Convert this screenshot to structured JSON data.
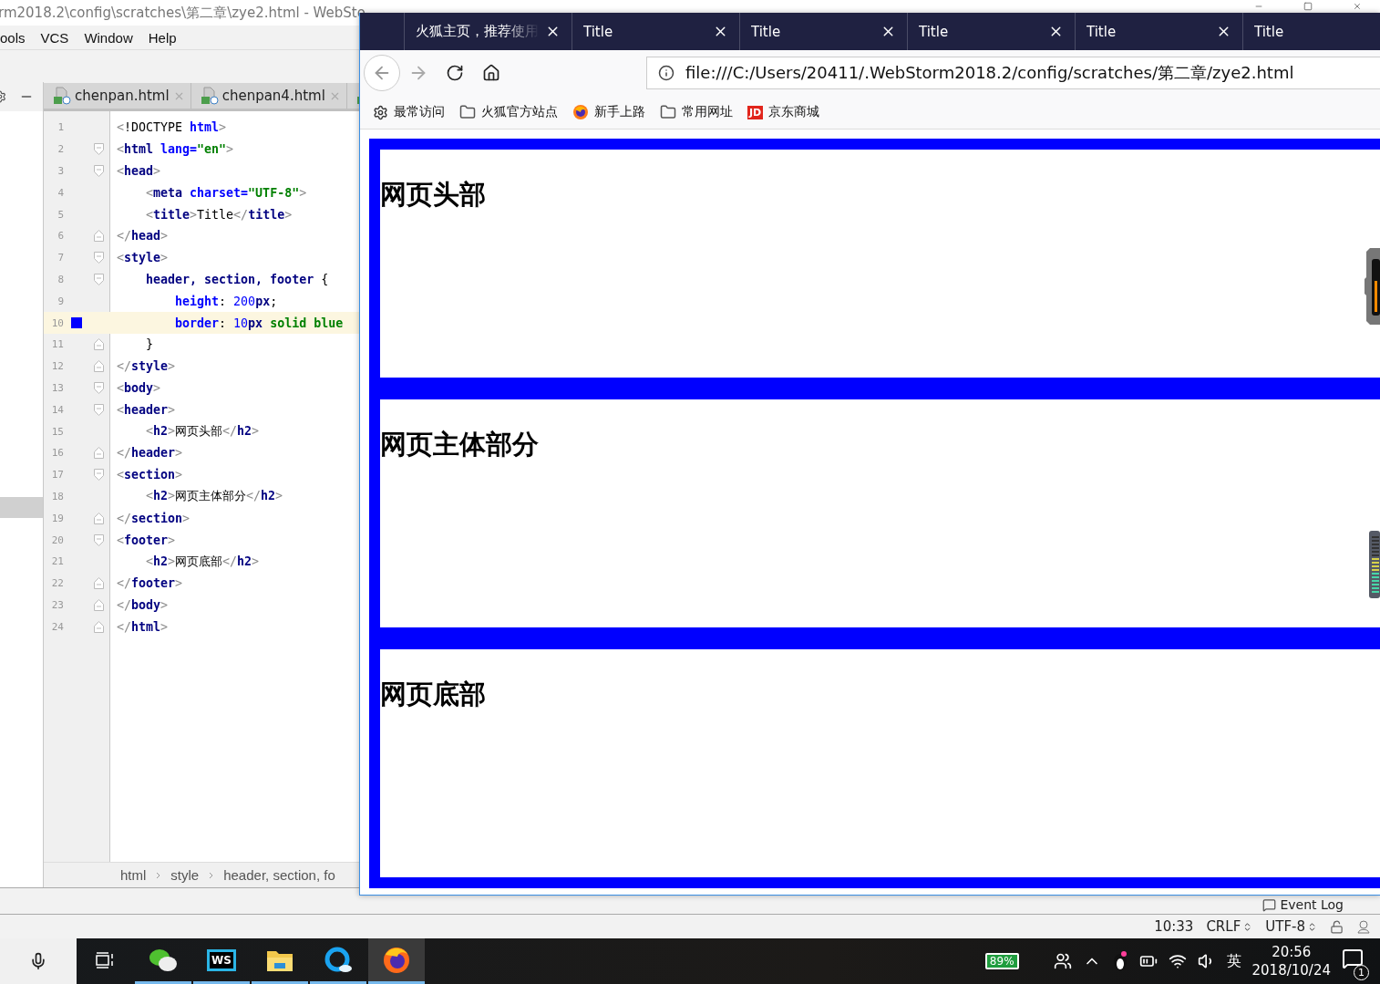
{
  "ide": {
    "title": "rm2018.2\\config\\scratches\\第二章\\zye2.html - WebSto",
    "menu": [
      "ools",
      "VCS",
      "Window",
      "Help"
    ],
    "editor_tabs": [
      {
        "label": "chenpan.html",
        "selected": false
      },
      {
        "label": "chenpan4.html",
        "selected": false
      }
    ],
    "lines": [
      {
        "number": "1",
        "kind": "plain",
        "current": false,
        "tokens": [
          {
            "kind": "p",
            "text": "<"
          },
          {
            "kind": "x",
            "text": "!DOCTYPE "
          },
          {
            "kind": "a",
            "text": "html"
          },
          {
            "kind": "p",
            "text": ">"
          }
        ]
      },
      {
        "number": "2",
        "kind": "open",
        "current": false,
        "tokens": [
          {
            "kind": "p",
            "text": "<"
          },
          {
            "kind": "t",
            "text": "html "
          },
          {
            "kind": "a",
            "text": "lang="
          },
          {
            "kind": "s",
            "text": "\"en\""
          },
          {
            "kind": "p",
            "text": ">"
          }
        ]
      },
      {
        "number": "3",
        "kind": "open",
        "current": false,
        "tokens": [
          {
            "kind": "p",
            "text": "<"
          },
          {
            "kind": "t",
            "text": "head"
          },
          {
            "kind": "p",
            "text": ">"
          }
        ]
      },
      {
        "number": "4",
        "kind": "plain",
        "current": false,
        "tokens": [
          {
            "kind": "p",
            "text": "    <"
          },
          {
            "kind": "t",
            "text": "meta "
          },
          {
            "kind": "a",
            "text": "charset="
          },
          {
            "kind": "s",
            "text": "\"UTF-8\""
          },
          {
            "kind": "p",
            "text": ">"
          }
        ]
      },
      {
        "number": "5",
        "kind": "plain",
        "current": false,
        "tokens": [
          {
            "kind": "p",
            "text": "    <"
          },
          {
            "kind": "t",
            "text": "title"
          },
          {
            "kind": "p",
            "text": ">"
          },
          {
            "kind": "x",
            "text": "Title"
          },
          {
            "kind": "p",
            "text": "</"
          },
          {
            "kind": "t",
            "text": "title"
          },
          {
            "kind": "p",
            "text": ">"
          }
        ]
      },
      {
        "number": "6",
        "kind": "close",
        "current": false,
        "tokens": [
          {
            "kind": "p",
            "text": "</"
          },
          {
            "kind": "t",
            "text": "head"
          },
          {
            "kind": "p",
            "text": ">"
          }
        ]
      },
      {
        "number": "7",
        "kind": "open",
        "current": false,
        "tokens": [
          {
            "kind": "p",
            "text": "<"
          },
          {
            "kind": "t",
            "text": "style"
          },
          {
            "kind": "p",
            "text": ">"
          }
        ]
      },
      {
        "number": "8",
        "kind": "open",
        "current": false,
        "tokens": [
          {
            "kind": "t",
            "text": "    header, section, footer"
          },
          {
            "kind": "x",
            "text": " {"
          }
        ]
      },
      {
        "number": "9",
        "kind": "plain",
        "current": false,
        "tokens": [
          {
            "kind": "a",
            "text": "        height"
          },
          {
            "kind": "x",
            "text": ": "
          },
          {
            "kind": "n",
            "text": "200"
          },
          {
            "kind": "t",
            "text": "px"
          },
          {
            "kind": "x",
            "text": ";"
          }
        ]
      },
      {
        "number": "10",
        "kind": "plain",
        "current": true,
        "color": "#0000ff",
        "tokens": [
          {
            "kind": "a",
            "text": "        border"
          },
          {
            "kind": "x",
            "text": ": "
          },
          {
            "kind": "n",
            "text": "10"
          },
          {
            "kind": "t",
            "text": "px "
          },
          {
            "kind": "k",
            "text": "solid blue"
          }
        ]
      },
      {
        "number": "11",
        "kind": "close",
        "current": false,
        "tokens": [
          {
            "kind": "x",
            "text": "    }"
          }
        ]
      },
      {
        "number": "12",
        "kind": "close",
        "current": false,
        "tokens": [
          {
            "kind": "p",
            "text": "</"
          },
          {
            "kind": "t",
            "text": "style"
          },
          {
            "kind": "p",
            "text": ">"
          }
        ]
      },
      {
        "number": "13",
        "kind": "open",
        "current": false,
        "tokens": [
          {
            "kind": "p",
            "text": "<"
          },
          {
            "kind": "t",
            "text": "body"
          },
          {
            "kind": "p",
            "text": ">"
          }
        ]
      },
      {
        "number": "14",
        "kind": "open",
        "current": false,
        "tokens": [
          {
            "kind": "p",
            "text": "<"
          },
          {
            "kind": "t",
            "text": "header"
          },
          {
            "kind": "p",
            "text": ">"
          }
        ]
      },
      {
        "number": "15",
        "kind": "plain",
        "current": false,
        "tokens": [
          {
            "kind": "p",
            "text": "    <"
          },
          {
            "kind": "t",
            "text": "h2"
          },
          {
            "kind": "p",
            "text": ">"
          },
          {
            "kind": "x",
            "text": "网页头部"
          },
          {
            "kind": "p",
            "text": "</"
          },
          {
            "kind": "t",
            "text": "h2"
          },
          {
            "kind": "p",
            "text": ">"
          }
        ]
      },
      {
        "number": "16",
        "kind": "close",
        "current": false,
        "tokens": [
          {
            "kind": "p",
            "text": "</"
          },
          {
            "kind": "t",
            "text": "header"
          },
          {
            "kind": "p",
            "text": ">"
          }
        ]
      },
      {
        "number": "17",
        "kind": "open",
        "current": false,
        "tokens": [
          {
            "kind": "p",
            "text": "<"
          },
          {
            "kind": "t",
            "text": "section"
          },
          {
            "kind": "p",
            "text": ">"
          }
        ]
      },
      {
        "number": "18",
        "kind": "plain",
        "current": false,
        "tokens": [
          {
            "kind": "p",
            "text": "    <"
          },
          {
            "kind": "t",
            "text": "h2"
          },
          {
            "kind": "p",
            "text": ">"
          },
          {
            "kind": "x",
            "text": "网页主体部分"
          },
          {
            "kind": "p",
            "text": "</"
          },
          {
            "kind": "t",
            "text": "h2"
          },
          {
            "kind": "p",
            "text": ">"
          }
        ]
      },
      {
        "number": "19",
        "kind": "close",
        "current": false,
        "tokens": [
          {
            "kind": "p",
            "text": "</"
          },
          {
            "kind": "t",
            "text": "section"
          },
          {
            "kind": "p",
            "text": ">"
          }
        ]
      },
      {
        "number": "20",
        "kind": "open",
        "current": false,
        "tokens": [
          {
            "kind": "p",
            "text": "<"
          },
          {
            "kind": "t",
            "text": "footer"
          },
          {
            "kind": "p",
            "text": ">"
          }
        ]
      },
      {
        "number": "21",
        "kind": "plain",
        "current": false,
        "tokens": [
          {
            "kind": "p",
            "text": "    <"
          },
          {
            "kind": "t",
            "text": "h2"
          },
          {
            "kind": "p",
            "text": ">"
          },
          {
            "kind": "x",
            "text": "网页底部"
          },
          {
            "kind": "p",
            "text": "</"
          },
          {
            "kind": "t",
            "text": "h2"
          },
          {
            "kind": "p",
            "text": ">"
          }
        ]
      },
      {
        "number": "22",
        "kind": "close",
        "current": false,
        "tokens": [
          {
            "kind": "p",
            "text": "</"
          },
          {
            "kind": "t",
            "text": "footer"
          },
          {
            "kind": "p",
            "text": ">"
          }
        ]
      },
      {
        "number": "23",
        "kind": "close",
        "current": false,
        "tokens": [
          {
            "kind": "p",
            "text": "</"
          },
          {
            "kind": "t",
            "text": "body"
          },
          {
            "kind": "p",
            "text": ">"
          }
        ]
      },
      {
        "number": "24",
        "kind": "close",
        "current": false,
        "tokens": [
          {
            "kind": "p",
            "text": "</"
          },
          {
            "kind": "t",
            "text": "html"
          },
          {
            "kind": "p",
            "text": ">"
          }
        ]
      }
    ],
    "breadcrumbs": [
      "html",
      "style",
      "header, section, fo"
    ],
    "event_log": "Event Log",
    "status": {
      "position": "10:33",
      "line_separator": "CRLF",
      "encoding": "UTF-8"
    }
  },
  "browser": {
    "tabs": [
      {
        "label": "火狐主页，推荐使用",
        "selected": false
      },
      {
        "label": "Title",
        "selected": false
      },
      {
        "label": "Title",
        "selected": false
      },
      {
        "label": "Title",
        "selected": false
      },
      {
        "label": "Title",
        "selected": false
      },
      {
        "label": "Title",
        "selected": false
      }
    ],
    "url": "file:///C:/Users/20411/.WebStorm2018.2/config/scratches/第二章/zye2.html",
    "bookmarks": [
      {
        "kind": "smart",
        "label": "最常访问"
      },
      {
        "kind": "folder",
        "label": "火狐官方站点"
      },
      {
        "kind": "site",
        "label": "新手上路"
      },
      {
        "kind": "folder",
        "label": "常用网址"
      },
      {
        "kind": "logo",
        "badge": "JD",
        "label": "京东商城"
      }
    ],
    "sections": [
      {
        "heading": "网页头部"
      },
      {
        "heading": "网页主体部分"
      },
      {
        "heading": "网页底部"
      }
    ]
  },
  "taskbar": {
    "apps": [
      {
        "kind": "wechat",
        "running": true,
        "selected": false
      },
      {
        "kind": "webstorm",
        "badge": "WS",
        "running": true,
        "selected": false
      },
      {
        "kind": "explorer",
        "running": true,
        "selected": false
      },
      {
        "kind": "qbrowser",
        "running": true,
        "selected": false
      },
      {
        "kind": "firefox",
        "running": true,
        "selected": true
      }
    ],
    "battery": "89%",
    "ime": "英",
    "time": "20:56",
    "date": "2018/10/24",
    "notifications": "1"
  }
}
